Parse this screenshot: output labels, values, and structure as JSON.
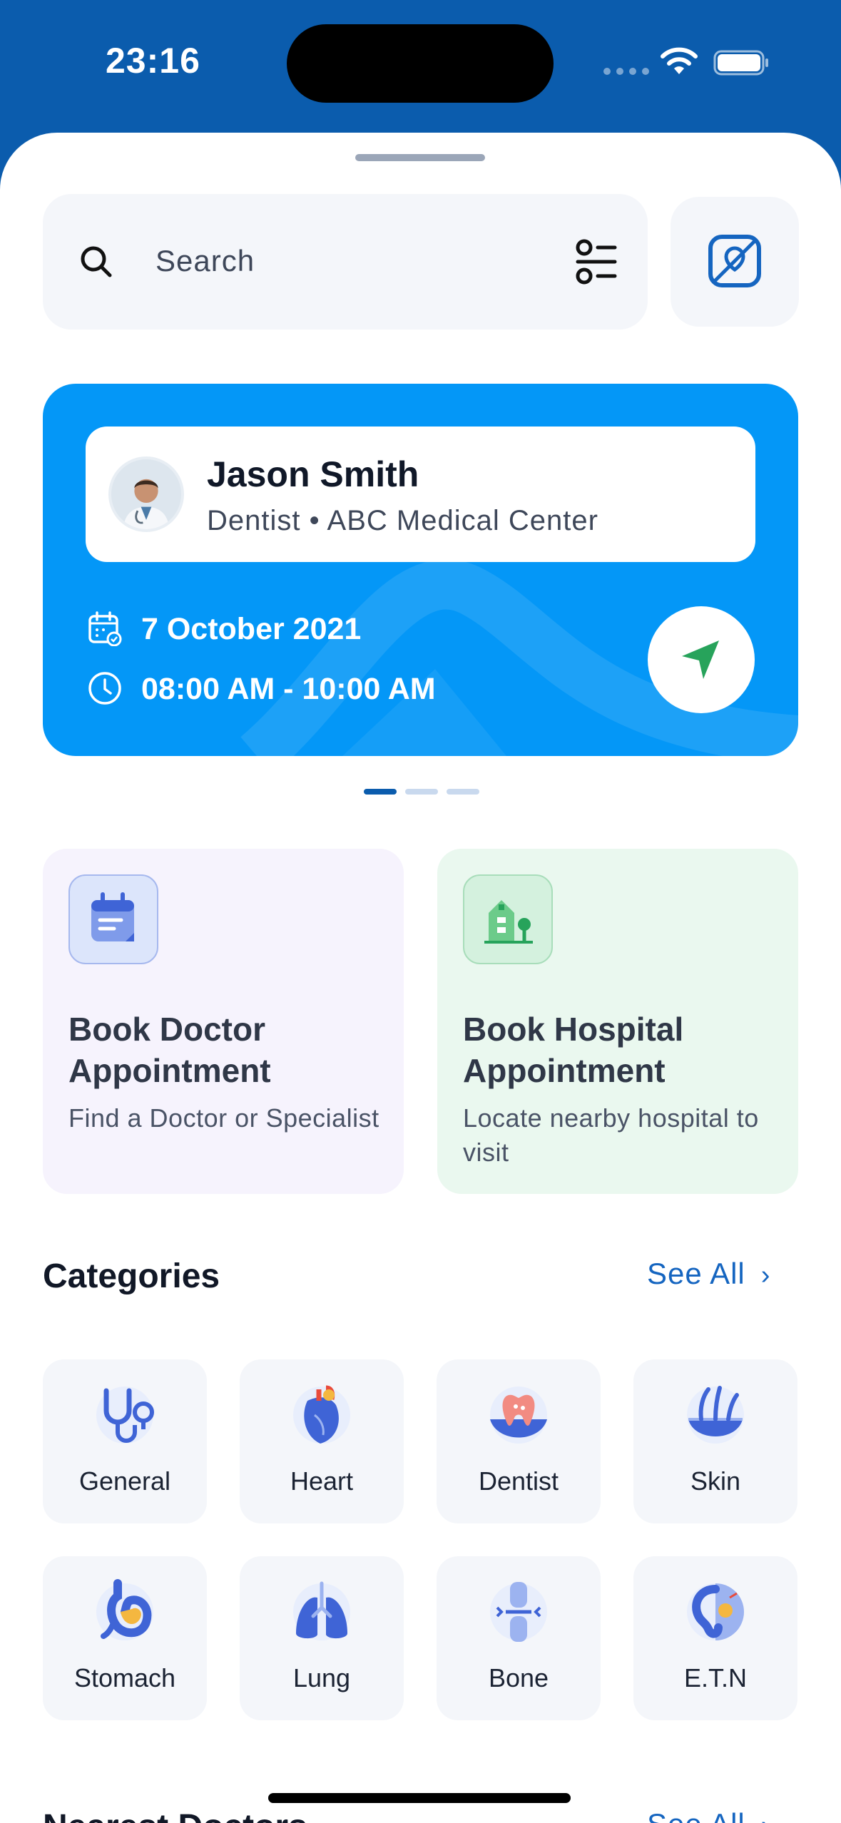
{
  "status_bar": {
    "time": "23:16"
  },
  "search": {
    "placeholder": "Search"
  },
  "appointment": {
    "doctor_name": "Jason Smith",
    "doctor_specialty": "Dentist",
    "separator": "•",
    "clinic": "ABC Medical Center",
    "date": "7 October 2021",
    "time_range": "08:00 AM - 10:00 AM"
  },
  "carousel": {
    "pages": 3,
    "active_index": 0
  },
  "quick_actions": [
    {
      "title": "Book Doctor Appointment",
      "description": "Find a Doctor or Specialist",
      "icon": "calendar-note-icon"
    },
    {
      "title": "Book Hospital Appointment",
      "description": "Locate nearby hospital to visit",
      "icon": "hospital-building-icon"
    }
  ],
  "categories": {
    "title": "Categories",
    "see_all": "See All",
    "items": [
      {
        "label": "General",
        "icon": "stethoscope-icon"
      },
      {
        "label": "Heart",
        "icon": "heart-icon"
      },
      {
        "label": "Dentist",
        "icon": "tooth-icon"
      },
      {
        "label": "Skin",
        "icon": "skin-icon"
      },
      {
        "label": "Stomach",
        "icon": "stomach-icon"
      },
      {
        "label": "Lung",
        "icon": "lung-icon"
      },
      {
        "label": "Bone",
        "icon": "bone-icon"
      },
      {
        "label": "E.T.N",
        "icon": "ear-icon"
      }
    ]
  },
  "nearest_doctors": {
    "title": "Nearest Doctors",
    "see_all": "See All"
  },
  "colors": {
    "header_blue": "#0B5CAD",
    "card_blue": "#0497F7",
    "send_green": "#27A35B",
    "link_blue": "#1565C0",
    "doctor_card_bg": "#F6F3FD",
    "hospital_card_bg": "#EAF8EF"
  }
}
